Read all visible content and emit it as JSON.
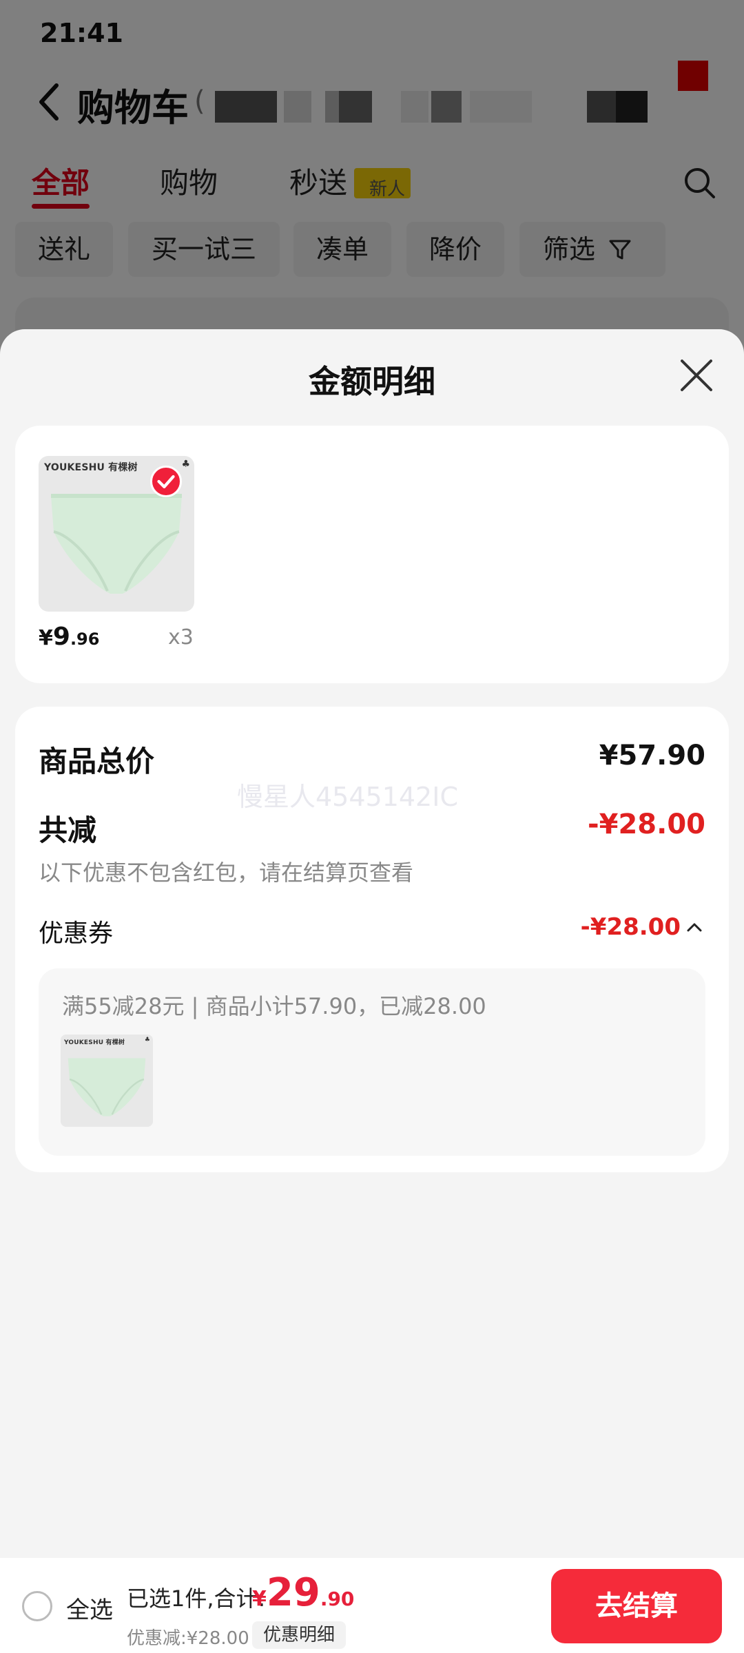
{
  "status_bar": {
    "time": "21:41"
  },
  "background_page": {
    "title": "购物车",
    "title_paren": "(",
    "tabs": [
      {
        "label": "全部",
        "active": true
      },
      {
        "label": "购物",
        "active": false
      },
      {
        "label": "秒送",
        "active": false
      }
    ],
    "tab_badge": "新人",
    "chips": [
      "送礼",
      "买一试三",
      "凑单",
      "降价",
      "筛选"
    ]
  },
  "sheet": {
    "title": "金额明细",
    "product": {
      "brand": "YOUKESHU 有棵树",
      "price_currency": "¥",
      "price_int": "9",
      "price_dec": ".96",
      "quantity": "x3"
    },
    "summary": {
      "total_label": "商品总价",
      "total_value": "¥57.90",
      "watermark": "慢星人4545142IC",
      "reduce_label": "共减",
      "reduce_value": "-¥28.00",
      "reduce_note": "以下优惠不包含红包，请在结算页查看",
      "coupon_label": "优惠券",
      "coupon_value": "-¥28.00",
      "coupon_desc": "满55减28元 | 商品小计57.90，已减28.00"
    }
  },
  "bottom_bar": {
    "select_all": "全选",
    "selected_count": "已选1件,合计:",
    "total_currency": "¥",
    "total_int": "29",
    "total_dec": ".90",
    "discount": "优惠减:¥28.00",
    "detail_button": "优惠明细",
    "checkout_button": "去结算"
  },
  "colors": {
    "accent_red": "#e3001b",
    "checkout_red": "#f52b3a",
    "discount_red": "#e02020",
    "product_mint": "#d6ecd9"
  }
}
